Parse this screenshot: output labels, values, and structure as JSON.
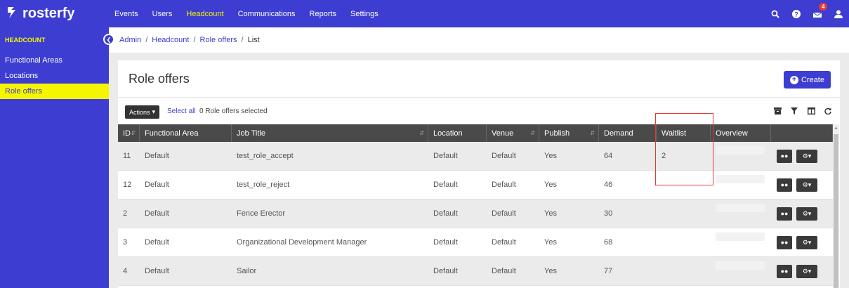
{
  "brand": {
    "name": "rosterfy"
  },
  "nav": {
    "items": [
      {
        "label": "Events",
        "active": false
      },
      {
        "label": "Users",
        "active": false
      },
      {
        "label": "Headcount",
        "active": true
      },
      {
        "label": "Communications",
        "active": false
      },
      {
        "label": "Reports",
        "active": false
      },
      {
        "label": "Settings",
        "active": false
      }
    ],
    "notification_count": "4"
  },
  "sidebar": {
    "heading": "HEADCOUNT",
    "items": [
      {
        "label": "Functional Areas",
        "active": false
      },
      {
        "label": "Locations",
        "active": false
      },
      {
        "label": "Role offers",
        "active": true
      }
    ]
  },
  "breadcrumb": {
    "items": [
      "Admin",
      "Headcount",
      "Role offers"
    ],
    "current": "List",
    "separator": "/"
  },
  "page": {
    "title": "Role offers",
    "create_label": "Create"
  },
  "toolbar": {
    "actions_label": "Actions",
    "select_all_label": "Select all",
    "selected_text": "0 Role offers selected"
  },
  "table": {
    "columns": [
      "ID",
      "Functional Area",
      "Job Title",
      "Location",
      "Venue",
      "Publish",
      "Demand",
      "Waitlist",
      "Overview",
      ""
    ],
    "rows": [
      {
        "id": "11",
        "functional_area": "Default",
        "job_title": "test_role_accept",
        "location": "Default",
        "venue": "Default",
        "publish": "Yes",
        "demand": "64",
        "waitlist": "2"
      },
      {
        "id": "12",
        "functional_area": "Default",
        "job_title": "test_role_reject",
        "location": "Default",
        "venue": "Default",
        "publish": "Yes",
        "demand": "46",
        "waitlist": ""
      },
      {
        "id": "2",
        "functional_area": "Default",
        "job_title": "Fence Erector",
        "location": "Default",
        "venue": "Default",
        "publish": "Yes",
        "demand": "30",
        "waitlist": ""
      },
      {
        "id": "3",
        "functional_area": "Default",
        "job_title": "Organizational Development Manager",
        "location": "Default",
        "venue": "Default",
        "publish": "Yes",
        "demand": "68",
        "waitlist": ""
      },
      {
        "id": "4",
        "functional_area": "Default",
        "job_title": "Sailor",
        "location": "Default",
        "venue": "Default",
        "publish": "Yes",
        "demand": "77",
        "waitlist": ""
      }
    ]
  },
  "colors": {
    "brand": "#3d3dd1",
    "accent": "#f5f500",
    "header": "#4a4a4a",
    "highlight": "#e53935"
  }
}
